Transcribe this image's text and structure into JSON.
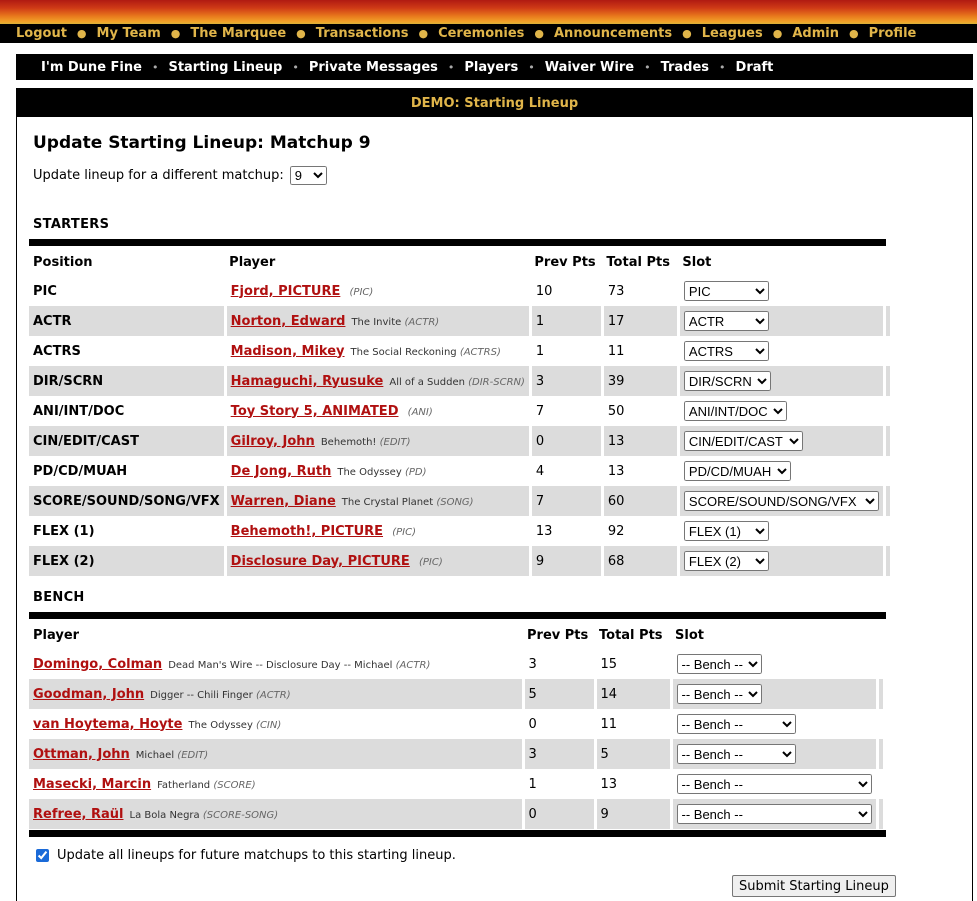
{
  "top_nav": [
    "Logout",
    "My Team",
    "The Marquee",
    "Transactions",
    "Ceremonies",
    "Announcements",
    "Leagues",
    "Admin",
    "Profile"
  ],
  "sub_nav": [
    "I'm Dune Fine",
    "Starting Lineup",
    "Private Messages",
    "Players",
    "Waiver Wire",
    "Trades",
    "Draft"
  ],
  "panel_title": "DEMO: Starting Lineup",
  "page_title": "Update Starting Lineup: Matchup 9",
  "matchup_label": "Update lineup for a different matchup:",
  "matchup_value": "9",
  "starters_label": "STARTERS",
  "bench_label": "BENCH",
  "starters_headers": {
    "position": "Position",
    "player": "Player",
    "prev": "Prev Pts",
    "total": "Total Pts",
    "slot": "Slot"
  },
  "bench_headers": {
    "player": "Player",
    "prev": "Prev Pts",
    "total": "Total Pts",
    "slot": "Slot"
  },
  "starters": [
    {
      "position": "PIC",
      "name": "Fjord, PICTURE",
      "film": "",
      "cat": "(PIC)",
      "prev": "10",
      "total": "73",
      "slot": "PIC"
    },
    {
      "position": "ACTR",
      "name": "Norton, Edward",
      "film": "The Invite",
      "cat": "(ACTR)",
      "prev": "1",
      "total": "17",
      "slot": "ACTR"
    },
    {
      "position": "ACTRS",
      "name": "Madison, Mikey",
      "film": "The Social Reckoning",
      "cat": "(ACTRS)",
      "prev": "1",
      "total": "11",
      "slot": "ACTRS"
    },
    {
      "position": "DIR/SCRN",
      "name": "Hamaguchi, Ryusuke",
      "film": "All of a Sudden",
      "cat": "(DIR-SCRN)",
      "prev": "3",
      "total": "39",
      "slot": "DIR/SCRN"
    },
    {
      "position": "ANI/INT/DOC",
      "name": "Toy Story 5, ANIMATED",
      "film": "",
      "cat": "(ANI)",
      "prev": "7",
      "total": "50",
      "slot": "ANI/INT/DOC"
    },
    {
      "position": "CIN/EDIT/CAST",
      "name": "Gilroy, John",
      "film": "Behemoth!",
      "cat": "(EDIT)",
      "prev": "0",
      "total": "13",
      "slot": "CIN/EDIT/CAST"
    },
    {
      "position": "PD/CD/MUAH",
      "name": "De Jong, Ruth",
      "film": "The Odyssey",
      "cat": "(PD)",
      "prev": "4",
      "total": "13",
      "slot": "PD/CD/MUAH"
    },
    {
      "position": "SCORE/SOUND/SONG/VFX",
      "name": "Warren, Diane",
      "film": "The Crystal Planet",
      "cat": "(SONG)",
      "prev": "7",
      "total": "60",
      "slot": "SCORE/SOUND/SONG/VFX"
    },
    {
      "position": "FLEX (1)",
      "name": "Behemoth!, PICTURE",
      "film": "",
      "cat": "(PIC)",
      "prev": "13",
      "total": "92",
      "slot": "FLEX (1)"
    },
    {
      "position": "FLEX (2)",
      "name": "Disclosure Day, PICTURE",
      "film": "",
      "cat": "(PIC)",
      "prev": "9",
      "total": "68",
      "slot": "FLEX (2)"
    }
  ],
  "bench": [
    {
      "name": "Domingo, Colman",
      "film": "Dead Man's Wire -- Disclosure Day -- Michael",
      "cat": "(ACTR)",
      "prev": "3",
      "total": "15",
      "slot": "-- Bench --"
    },
    {
      "name": "Goodman, John",
      "film": "Digger -- Chili Finger",
      "cat": "(ACTR)",
      "prev": "5",
      "total": "14",
      "slot": "-- Bench --"
    },
    {
      "name": "van Hoytema, Hoyte",
      "film": "The Odyssey",
      "cat": "(CIN)",
      "prev": "0",
      "total": "11",
      "slot": "-- Bench --"
    },
    {
      "name": "Ottman, John",
      "film": "Michael",
      "cat": "(EDIT)",
      "prev": "3",
      "total": "5",
      "slot": "-- Bench --"
    },
    {
      "name": "Masecki, Marcin",
      "film": "Fatherland",
      "cat": "(SCORE)",
      "prev": "1",
      "total": "13",
      "slot": "-- Bench --"
    },
    {
      "name": "Refree, Raül",
      "film": "La Bola Negra",
      "cat": "(SCORE-SONG)",
      "prev": "0",
      "total": "9",
      "slot": "-- Bench --"
    }
  ],
  "future_checkbox_label": "Update all lineups for future matchups to this starting lineup.",
  "future_checked": true,
  "submit_label": "Submit Starting Lineup"
}
